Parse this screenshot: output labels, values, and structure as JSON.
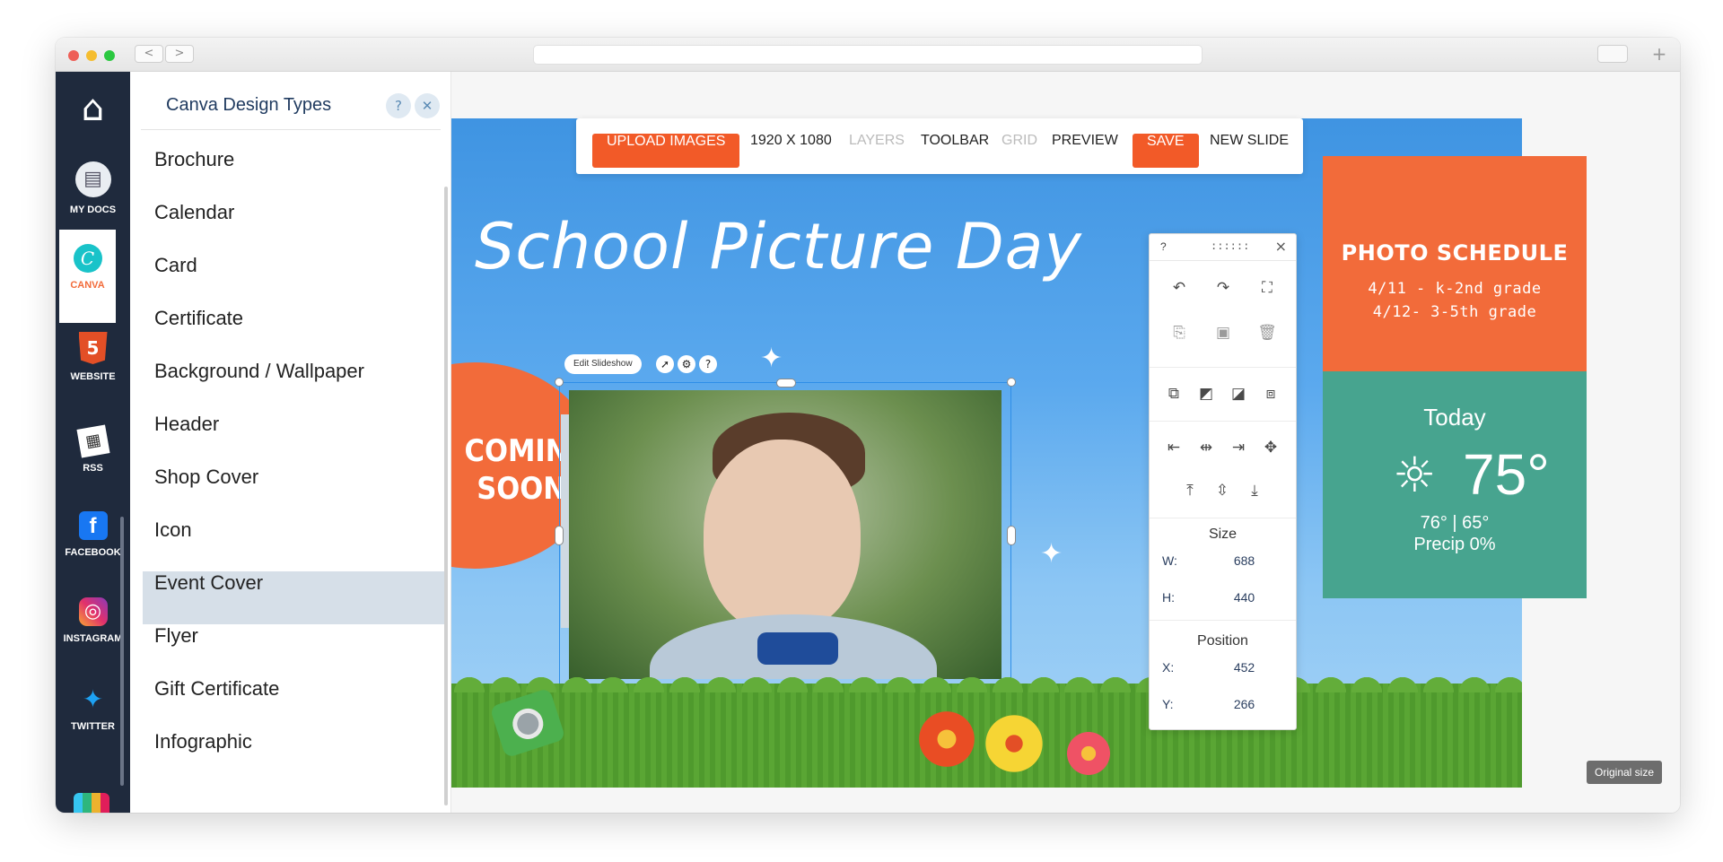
{
  "browser": {
    "back_glyph": "<",
    "forward_glyph": ">",
    "new_tab_glyph": "+"
  },
  "rail": {
    "items": [
      {
        "label": "",
        "icon": "home-icon",
        "glyph": "⌂"
      },
      {
        "label": "MY DOCS",
        "icon": "docs-icon",
        "glyph": "▤"
      },
      {
        "label": "CANVA",
        "icon": "canva-icon",
        "glyph": "C"
      },
      {
        "label": "WEBSITE",
        "icon": "html5-icon",
        "glyph": "5"
      },
      {
        "label": "RSS",
        "icon": "news-icon",
        "glyph": "▦"
      },
      {
        "label": "FACEBOOK",
        "icon": "facebook-icon",
        "glyph": "f"
      },
      {
        "label": "INSTAGRAM",
        "icon": "instagram-icon",
        "glyph": "◎"
      },
      {
        "label": "TWITTER",
        "icon": "twitter-icon",
        "glyph": "✦"
      }
    ]
  },
  "panel": {
    "title": "Canva Design Types",
    "help_glyph": "?",
    "close_glyph": "✕",
    "items": [
      "Brochure",
      "Calendar",
      "Card",
      "Certificate",
      "Background / Wallpaper",
      "Header",
      "Shop Cover",
      "Icon",
      "Event Cover",
      "Flyer",
      "Gift Certificate",
      "Infographic"
    ],
    "selected": "Event Cover"
  },
  "toolbar": {
    "upload": "UPLOAD IMAGES",
    "dimensions": "1920 X 1080",
    "layers": "LAYERS",
    "toolbar": "TOOLBAR",
    "grid": "GRID",
    "preview": "PREVIEW",
    "save": "SAVE",
    "new_slide": "NEW SLIDE"
  },
  "canvas": {
    "title": "School Picture Day",
    "coming_soon_1": "COMING",
    "coming_soon_2": "SOON!",
    "edit_chip": "Edit Slideshow"
  },
  "photo_schedule": {
    "heading": "PHOTO SCHEDULE",
    "line1": "4/11 - k-2nd grade",
    "line2": "4/12- 3-5th grade"
  },
  "weather": {
    "label": "Today",
    "temp": "75°",
    "range": "76° | 65°",
    "precip": "Precip 0%"
  },
  "side_panel": {
    "help": "?",
    "grip": "::::::",
    "close": "×",
    "size_label": "Size",
    "w_label": "W:",
    "w_value": "688",
    "h_label": "H:",
    "h_value": "440",
    "position_label": "Position",
    "x_label": "X:",
    "x_value": "452",
    "y_label": "Y:",
    "y_value": "266"
  },
  "original_size": "Original size",
  "colors": {
    "accent_orange": "#f25a28",
    "rail_bg": "#1f2a3d",
    "weather_green": "#47a48f",
    "sky_blue": "#4a9be6"
  }
}
